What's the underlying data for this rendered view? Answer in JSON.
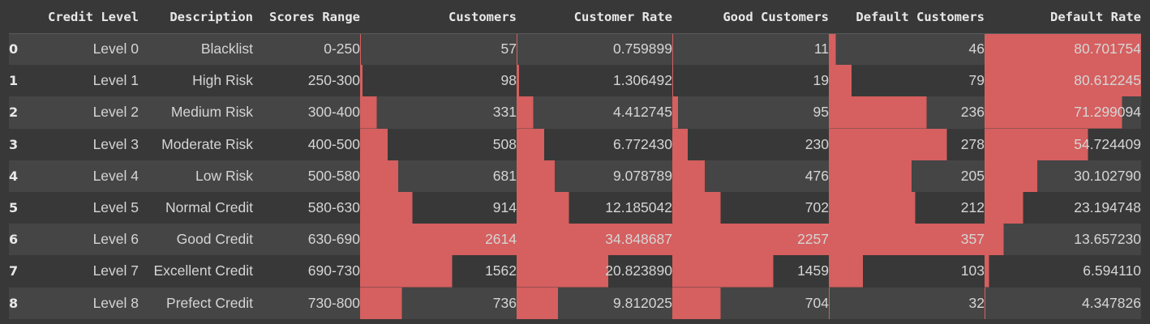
{
  "bar_color": "#d65f5f",
  "headers": {
    "index": "",
    "credit_level": "Credit Level",
    "description": "Description",
    "scores_range": "Scores Range",
    "customers": "Customers",
    "customer_rate": "Customer Rate",
    "good_customers": "Good Customers",
    "default_customers": "Default Customers",
    "default_rate": "Default Rate"
  },
  "rows": [
    {
      "index": "0",
      "credit_level": "Level 0",
      "description": "Blacklist",
      "scores_range": "0-250",
      "customers": "57",
      "customer_rate": "0.759899",
      "good_customers": "11",
      "default_customers": "46",
      "default_rate": "80.701754"
    },
    {
      "index": "1",
      "credit_level": "Level 1",
      "description": "High Risk",
      "scores_range": "250-300",
      "customers": "98",
      "customer_rate": "1.306492",
      "good_customers": "19",
      "default_customers": "79",
      "default_rate": "80.612245"
    },
    {
      "index": "2",
      "credit_level": "Level 2",
      "description": "Medium Risk",
      "scores_range": "300-400",
      "customers": "331",
      "customer_rate": "4.412745",
      "good_customers": "95",
      "default_customers": "236",
      "default_rate": "71.299094"
    },
    {
      "index": "3",
      "credit_level": "Level 3",
      "description": "Moderate Risk",
      "scores_range": "400-500",
      "customers": "508",
      "customer_rate": "6.772430",
      "good_customers": "230",
      "default_customers": "278",
      "default_rate": "54.724409"
    },
    {
      "index": "4",
      "credit_level": "Level 4",
      "description": "Low Risk",
      "scores_range": "500-580",
      "customers": "681",
      "customer_rate": "9.078789",
      "good_customers": "476",
      "default_customers": "205",
      "default_rate": "30.102790"
    },
    {
      "index": "5",
      "credit_level": "Level 5",
      "description": "Normal Credit",
      "scores_range": "580-630",
      "customers": "914",
      "customer_rate": "12.185042",
      "good_customers": "702",
      "default_customers": "212",
      "default_rate": "23.194748"
    },
    {
      "index": "6",
      "credit_level": "Level 6",
      "description": "Good Credit",
      "scores_range": "630-690",
      "customers": "2614",
      "customer_rate": "34.848687",
      "good_customers": "2257",
      "default_customers": "357",
      "default_rate": "13.657230"
    },
    {
      "index": "7",
      "credit_level": "Level 7",
      "description": "Excellent Credit",
      "scores_range": "690-730",
      "customers": "1562",
      "customer_rate": "20.823890",
      "good_customers": "1459",
      "default_customers": "103",
      "default_rate": "6.594110"
    },
    {
      "index": "8",
      "credit_level": "Level 8",
      "description": "Prefect Credit",
      "scores_range": "730-800",
      "customers": "736",
      "customer_rate": "9.812025",
      "good_customers": "704",
      "default_customers": "32",
      "default_rate": "4.347826"
    }
  ]
}
